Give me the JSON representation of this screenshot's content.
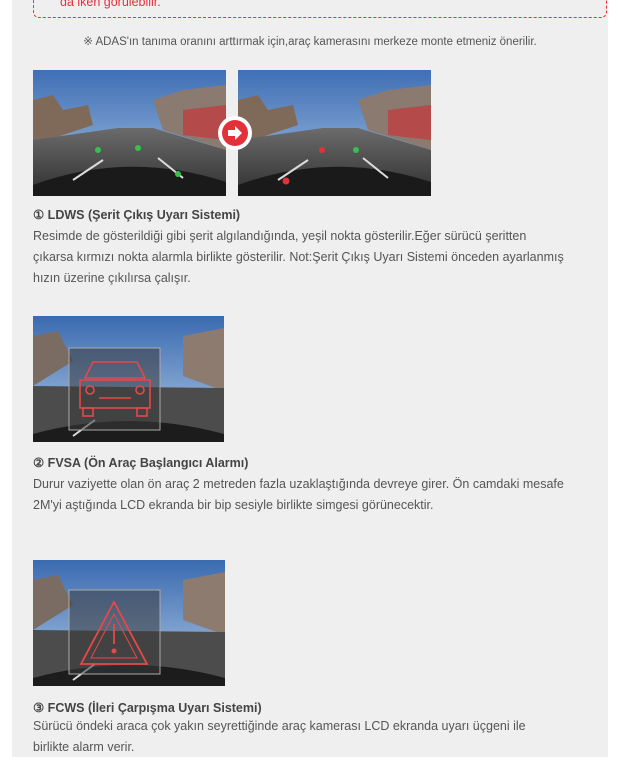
{
  "notice": {
    "text": "da iken görülebilir."
  },
  "mount_note": "※ ADAS'ın tanıma oranını arttırmak için,araç  kamerasını merkeze monte etmeniz önerilir.",
  "sections": [
    {
      "title": "① LDWS (Şerit Çıkış Uyarı Sistemi)",
      "lines": [
        "Resimde de gösterildiği gibi şerit algılandığında, yeşil nokta gösterilir.Eğer sürücü şeritten",
        "çıkarsa kırmızı nokta alarmla birlikte gösterilir. Not:Şerit Çıkış Uyarı Sistemi önceden ayarlanmış",
        "hızın üzerine çıkılırsa çalışır."
      ]
    },
    {
      "title": "② FVSA (Ön Araç Başlangıcı Alarmı)",
      "lines": [
        "Durur vaziyette olan ön araç 2 metreden fazla uzaklaştığında devreye girer. Ön camdaki mesafe",
        "2M'yi aştığında LCD ekranda bir bip sesiyle birlikte simgesi görünecektir."
      ]
    },
    {
      "title": "③ FCWS (İleri Çarpışma Uyarı Sistemi)",
      "lines": [
        "Sürücü öndeki araca çok yakın seyrettiğinde araç kamerası LCD ekranda uyarı üçgeni ile",
        "birlikte alarm verir."
      ]
    }
  ],
  "colors": {
    "accent": "#e3313a",
    "text": "#555555",
    "panel": "#efefef"
  },
  "icons": [
    "arrow-right-icon"
  ]
}
